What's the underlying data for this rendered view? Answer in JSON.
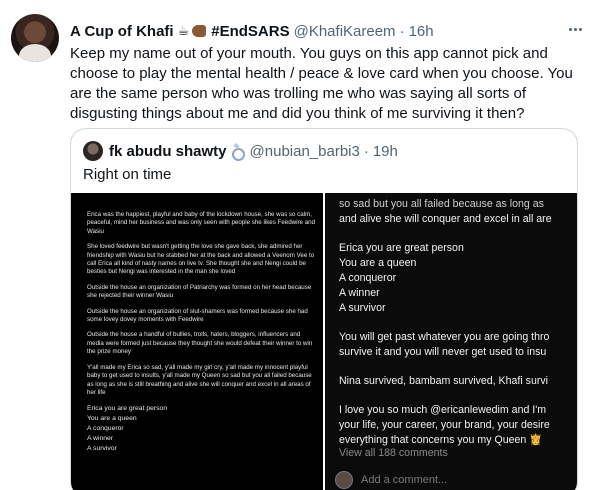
{
  "tweet": {
    "display_name": "A Cup of Khafi",
    "coffee_emoji": "☕",
    "hashtag": "#EndSARS",
    "handle": "@KhafiKareem",
    "separator": "·",
    "time": "16h",
    "text": "Keep my name out of your mouth. You guys on this app cannot pick and choose to play the mental health / peace & love card when you choose. You are the same person who was trolling me who was saying all sorts of disgusting things about me and did you think of me surviving it then?"
  },
  "quote": {
    "display_name": "fk abudu shawty",
    "handle": "@nubian_barbi3",
    "separator": "·",
    "time": "19h",
    "text": "Right on time",
    "image_left": {
      "paragraphs": [
        "Erica was the happiest, playful and baby of the lockdown house, she was so calm, peaceful, mind her business and was only seen with people she likes Feedwire and Wasiu",
        "She loved feedwire but wasn't getting the love she gave back, she admired her friendship with Wasiu but he stabbed her at the back and allowed a Veenom Vee to call Erica all kind of nasty names on live tv. She thought she and Nengi could be besties but Nengi was interested in the man she loved",
        "Outside the house an organization of Patriarchy was formed on her head because she rejected their winner Wasiu",
        "Outside the house an organization of slut-shamers was formed because she had some lovey dovey moments with Feedwire",
        "Outside the house a handful of bullies, trolls, haters, bloggers, influencers and media were formed just because they thought she would defeat their winner to win the prize money",
        "Y'all made my Erica so sad, y'all made my girl cry, y'all made my innocent playful baby to get used to insults, y'all made my Queen so sad but you all failed because as long as she is still breathing and alive she will conquer and excel in all areas of her life"
      ],
      "list": [
        "Erica you are great person",
        "You are a queen",
        "A conqueror",
        "A winner",
        "A survivor"
      ]
    },
    "image_right": {
      "top_lines": [
        "so sad but you all failed because as long as",
        "and alive she will conquer and excel in all are"
      ],
      "list": [
        "Erica you are great person",
        "You are a queen",
        "A conqueror",
        "A winner",
        "A survivor"
      ],
      "para1": [
        "You will get past whatever you are going thro",
        "survive it and you will never get used to insu"
      ],
      "para2": "Nina survived, bambam survived, Khafi survi",
      "para3": [
        "I love you so much @ericanlewedim and I'm",
        "your life, your career, your brand, your desire",
        "everything that concerns you my Queen 👸"
      ],
      "view_all": "View all 188 comments",
      "add_comment": "Add a comment..."
    }
  }
}
